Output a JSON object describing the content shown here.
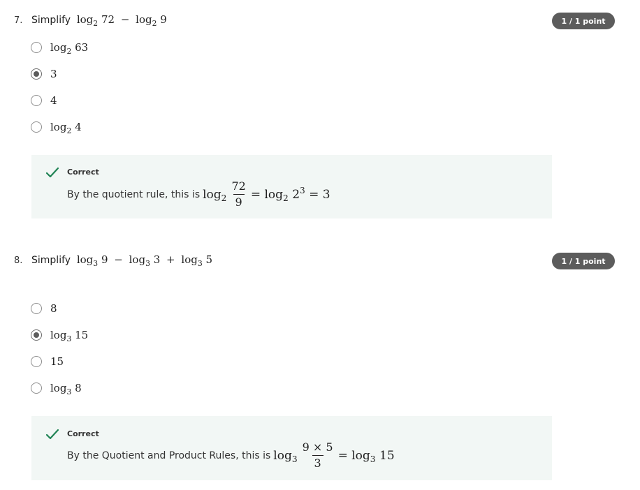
{
  "questions": [
    {
      "number": "7.",
      "prompt_lead": "Simplify",
      "prompt_math": {
        "a": "log",
        "a_base": "2",
        "a_arg": "72",
        "op1": "−",
        "b": "log",
        "b_base": "2",
        "b_arg": "9"
      },
      "score": "1 / 1 point",
      "options": [
        {
          "text": "log",
          "base": "2",
          "arg": "63",
          "selected": false
        },
        {
          "text": "3",
          "base": "",
          "arg": "",
          "selected": true
        },
        {
          "text": "4",
          "base": "",
          "arg": "",
          "selected": false
        },
        {
          "text": "log",
          "base": "2",
          "arg": "4",
          "selected": false
        }
      ],
      "feedback": {
        "status": "Correct",
        "lead": "By the quotient rule, this is",
        "log": "log",
        "log_base": "2",
        "frac_num": "72",
        "frac_den": "9",
        "rest_eq1": "=",
        "rest_log": "log",
        "rest_log_base": "2",
        "rest_base": "2",
        "rest_exp": "3",
        "rest_eq2": "= 3"
      }
    },
    {
      "number": "8.",
      "prompt_lead": "Simplify",
      "prompt_math": {
        "a": "log",
        "a_base": "3",
        "a_arg": "9",
        "op1": "−",
        "b": "log",
        "b_base": "3",
        "b_arg": "3",
        "op2": "+",
        "c": "log",
        "c_base": "3",
        "c_arg": "5"
      },
      "score": "1 / 1 point",
      "options": [
        {
          "text": "8",
          "base": "",
          "arg": "",
          "selected": false
        },
        {
          "text": "log",
          "base": "3",
          "arg": "15",
          "selected": true
        },
        {
          "text": "15",
          "base": "",
          "arg": "",
          "selected": false
        },
        {
          "text": "log",
          "base": "3",
          "arg": "8",
          "selected": false
        }
      ],
      "feedback": {
        "status": "Correct",
        "lead": "By the Quotient and Product Rules, this is",
        "log": "log",
        "log_base": "3",
        "frac_num": "9 × 5",
        "frac_den": "3",
        "rest_eq1": "=",
        "rest_log": "log",
        "rest_log_base": "3",
        "rest_arg": "15"
      }
    }
  ],
  "colors": {
    "badge_bg": "#5c5c5c",
    "feedback_bg": "#f2f7f5",
    "check_green": "#1f8354",
    "radio_border": "#8e8e8e"
  },
  "icons": {
    "correct": "check-icon"
  }
}
